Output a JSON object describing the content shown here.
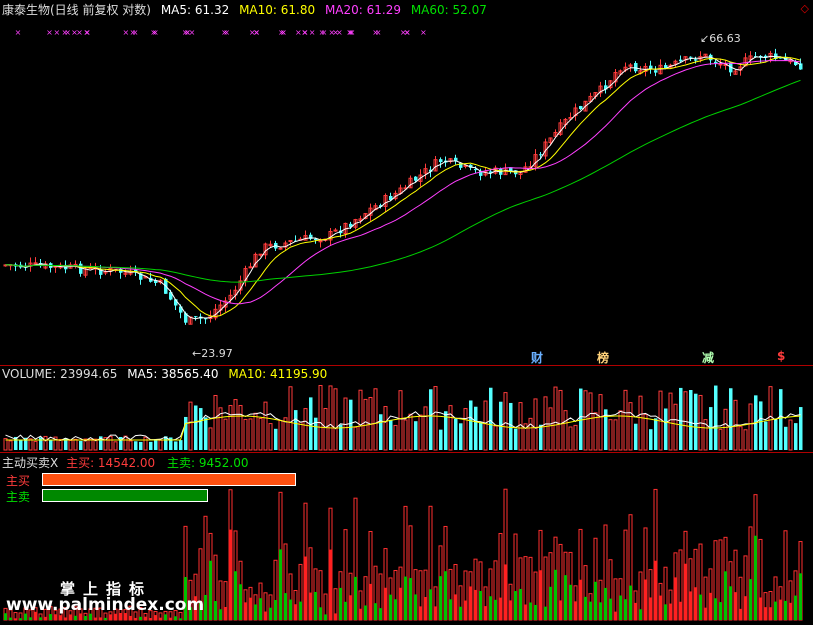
{
  "header": {
    "title": "康泰生物(日线 前复权 对数)",
    "ma5": "MA5: 61.32",
    "ma10": "MA10: 61.80",
    "ma20": "MA20: 61.29",
    "ma60": "MA60: 52.07"
  },
  "price_labels": {
    "high": "66.63",
    "low": "23.97"
  },
  "event_markers": {
    "cai": "财",
    "bang": "榜",
    "jian": "减",
    "dollar": "$"
  },
  "volume": {
    "label": "VOLUME: 23994.65",
    "ma5": "MA5: 38565.40",
    "ma10": "MA10: 41195.90"
  },
  "flow": {
    "label": "主动买卖X",
    "buy_summary": "主买: 14542.00",
    "sell_summary": "主卖: 9452.00",
    "buy_label": "主买",
    "sell_label": "主卖",
    "buy_value": 14542,
    "sell_value": 9452
  },
  "watermark": {
    "line1": "掌上指标",
    "line2": "www.palmindex.com"
  },
  "colors": {
    "up": "#ff3c3c",
    "down": "#54ffff",
    "ma5": "#ffffff",
    "ma10": "#ffff00",
    "ma20": "#ff40ff",
    "ma60": "#00d000",
    "buy_bar": "#ff5010",
    "sell_bar": "#008800"
  }
}
